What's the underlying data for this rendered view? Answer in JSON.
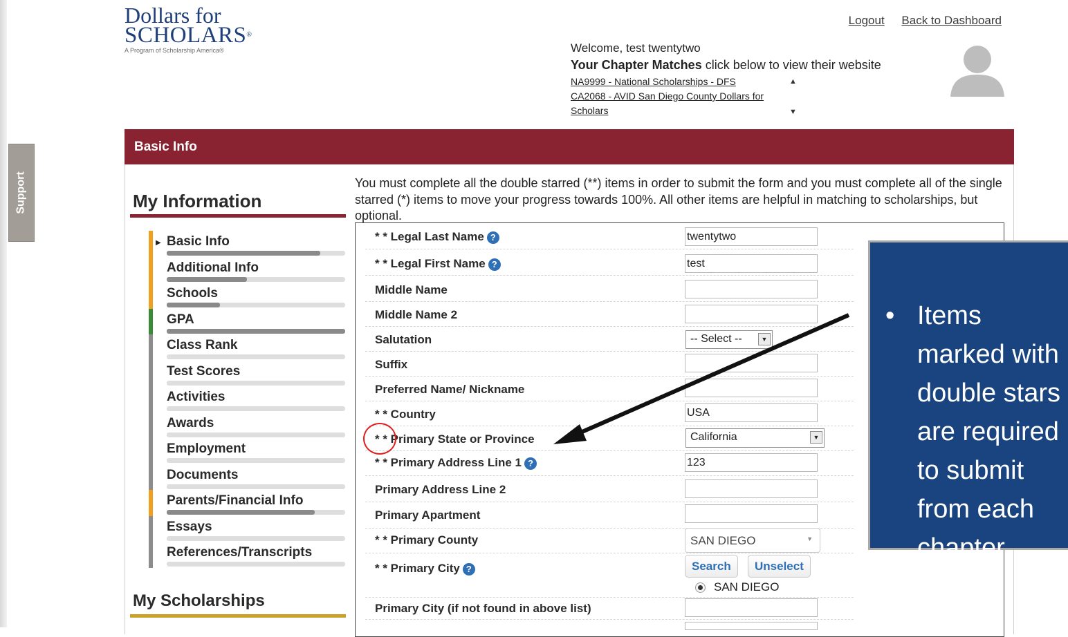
{
  "support_tab": {
    "label": "Support"
  },
  "logo": {
    "line1": "Dollars for",
    "line2": "SCHOLARS",
    "tagline": "A Program of Scholarship America®"
  },
  "header": {
    "logout": "Logout",
    "back": "Back to Dashboard",
    "welcome": "Welcome, test twentytwo",
    "matches_bold": "Your Chapter Matches",
    "matches_rest": " click below to view their website",
    "match_links": [
      "NA9999 - National Scholarships - DFS",
      "CA2068 - AVID San Diego County Dollars for Scholars"
    ]
  },
  "banner": {
    "title": "Basic Info"
  },
  "sidebar": {
    "title": "My Information",
    "items": [
      {
        "label": "Basic Info",
        "stripe": "#f0a020",
        "progress": 0.86,
        "active": true
      },
      {
        "label": "Additional Info",
        "stripe": "#f0a020",
        "progress": 0.45
      },
      {
        "label": "Schools",
        "stripe": "#f0a020",
        "progress": 0.3
      },
      {
        "label": "GPA",
        "stripe": "#3a8a3a",
        "progress": 1.0
      },
      {
        "label": "Class Rank",
        "stripe": "#8c8c8c",
        "progress": 0.0
      },
      {
        "label": "Test Scores",
        "stripe": "#8c8c8c",
        "progress": 0.0
      },
      {
        "label": "Activities",
        "stripe": "#8c8c8c",
        "progress": 0.0
      },
      {
        "label": "Awards",
        "stripe": "#8c8c8c",
        "progress": 0.0
      },
      {
        "label": "Employment",
        "stripe": "#8c8c8c",
        "progress": 0.0
      },
      {
        "label": "Documents",
        "stripe": "#8c8c8c",
        "progress": 0.0
      },
      {
        "label": "Parents/Financial Info",
        "stripe": "#f0a020",
        "progress": 0.83
      },
      {
        "label": "Essays",
        "stripe": "#8c8c8c",
        "progress": 0.0
      },
      {
        "label": "References/Transcripts",
        "stripe": "#8c8c8c",
        "progress": 0.0
      }
    ],
    "title2": "My Scholarships"
  },
  "intro": "You must complete all the double starred (**) items in order to submit the form and you must complete all of the single starred (*) items to move your progress towards 100%. All other items are helpful in matching to scholarships, but optional.",
  "form": {
    "legal_last": {
      "label": "* * Legal Last Name",
      "value": "twentytwo"
    },
    "legal_first": {
      "label": "* * Legal First Name",
      "value": "test"
    },
    "middle": {
      "label": "Middle Name",
      "value": ""
    },
    "middle2": {
      "label": "Middle Name 2",
      "value": ""
    },
    "salutation": {
      "label": "Salutation",
      "value": "-- Select --"
    },
    "suffix": {
      "label": "Suffix",
      "value": ""
    },
    "preferred": {
      "label": "Preferred Name/ Nickname",
      "value": ""
    },
    "country": {
      "label": "* * Country",
      "value": "USA"
    },
    "state": {
      "label": "* * Primary State or Province",
      "value": "California"
    },
    "addr1": {
      "label": "* * Primary Address Line 1",
      "value": "123"
    },
    "addr2": {
      "label": "Primary Address Line 2",
      "value": ""
    },
    "apt": {
      "label": "Primary Apartment",
      "value": ""
    },
    "county": {
      "label": "* * Primary County",
      "value": "SAN DIEGO"
    },
    "city": {
      "label": "* * Primary City",
      "search": "Search",
      "unselect": "Unselect",
      "selected": "SAN DIEGO"
    },
    "city_other": {
      "label": "Primary City (if not found in above list)",
      "value": ""
    }
  },
  "callout": {
    "text": "Items marked with double stars are required to submit from each chapter"
  }
}
